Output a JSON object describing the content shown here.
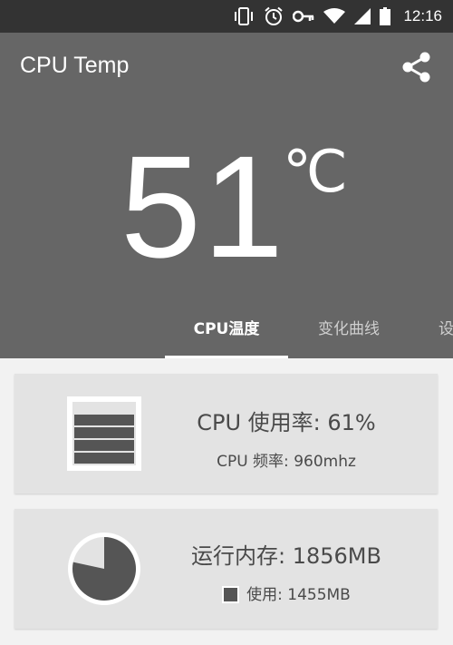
{
  "status_bar": {
    "time": "12:16",
    "icons": [
      "vibrate-icon",
      "alarm-icon",
      "key-icon",
      "wifi-icon",
      "signal-icon",
      "battery-icon"
    ]
  },
  "app_bar": {
    "title": "CPU Temp",
    "share_icon": "share-icon"
  },
  "temperature": {
    "value": "51",
    "unit": "℃"
  },
  "tabs": [
    {
      "label": "CPU温度",
      "active": true
    },
    {
      "label": "变化曲线",
      "active": false
    },
    {
      "label": "设",
      "active": false
    }
  ],
  "cpu_card": {
    "usage_text": "CPU 使用率: 61%",
    "freq_text": "CPU 频率: 960mhz"
  },
  "memory_card": {
    "total_text": "运行内存: 1856MB",
    "used_text": "使用: 1455MB",
    "used_fraction": 0.784
  },
  "colors": {
    "status_bar": "#333333",
    "app_bar": "#666666",
    "card": "#e3e3e3",
    "icon_fill": "#555555"
  }
}
